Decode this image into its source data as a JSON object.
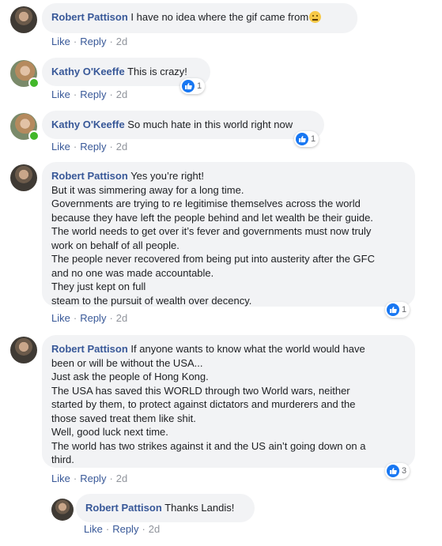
{
  "actions": {
    "like": "Like",
    "reply": "Reply",
    "separator": "·"
  },
  "comments": [
    {
      "author": "Robert Pattison",
      "lines": [
        "I have no idea where the gif came from"
      ],
      "emoji": "rolling-eyes-emoji",
      "time": "2d",
      "reactions": null
    },
    {
      "author": "Kathy O'Keeffe",
      "lines": [
        "This is crazy!"
      ],
      "time": "2d",
      "reactions": "1"
    },
    {
      "author": "Kathy O'Keeffe",
      "lines": [
        "So much hate in this world right now"
      ],
      "time": "2d",
      "reactions": "1"
    },
    {
      "author": "Robert Pattison",
      "lines": [
        "Yes you’re right!",
        "But it was simmering away for a long time.",
        "Governments are trying to re legitimise themselves across the world",
        "because they have left the people behind and let wealth be their guide.",
        "The world needs to get over it’s fever and governments must now truly",
        "work on behalf of all people.",
        "The people never recovered from being put into austerity after the GFC",
        "and no one was made accountable.",
        "They just kept on full",
        "steam to the pursuit of wealth over decency."
      ],
      "time": "2d",
      "reactions": "1"
    },
    {
      "author": "Robert Pattison",
      "lines": [
        "If anyone wants to know what the world would have",
        "been or will be without the USA...",
        "Just ask the people of Hong Kong.",
        "The USA has saved this WORLD through two World wars, neither",
        "started by them, to protect against dictators and murderers and the",
        "those saved treat them like shit.",
        "Well, good luck next time.",
        "The world has two strikes against it and the US ain’t going down on a",
        "third."
      ],
      "time": "2d",
      "reactions": "3"
    },
    {
      "author": "Robert Pattison",
      "lines": [
        "Thanks Landis!"
      ],
      "time": "2d",
      "reactions": null
    }
  ],
  "colors": {
    "author": "#385898",
    "bubble": "#f2f3f5",
    "like_badge": "#1877f2",
    "online": "#42b72a"
  }
}
